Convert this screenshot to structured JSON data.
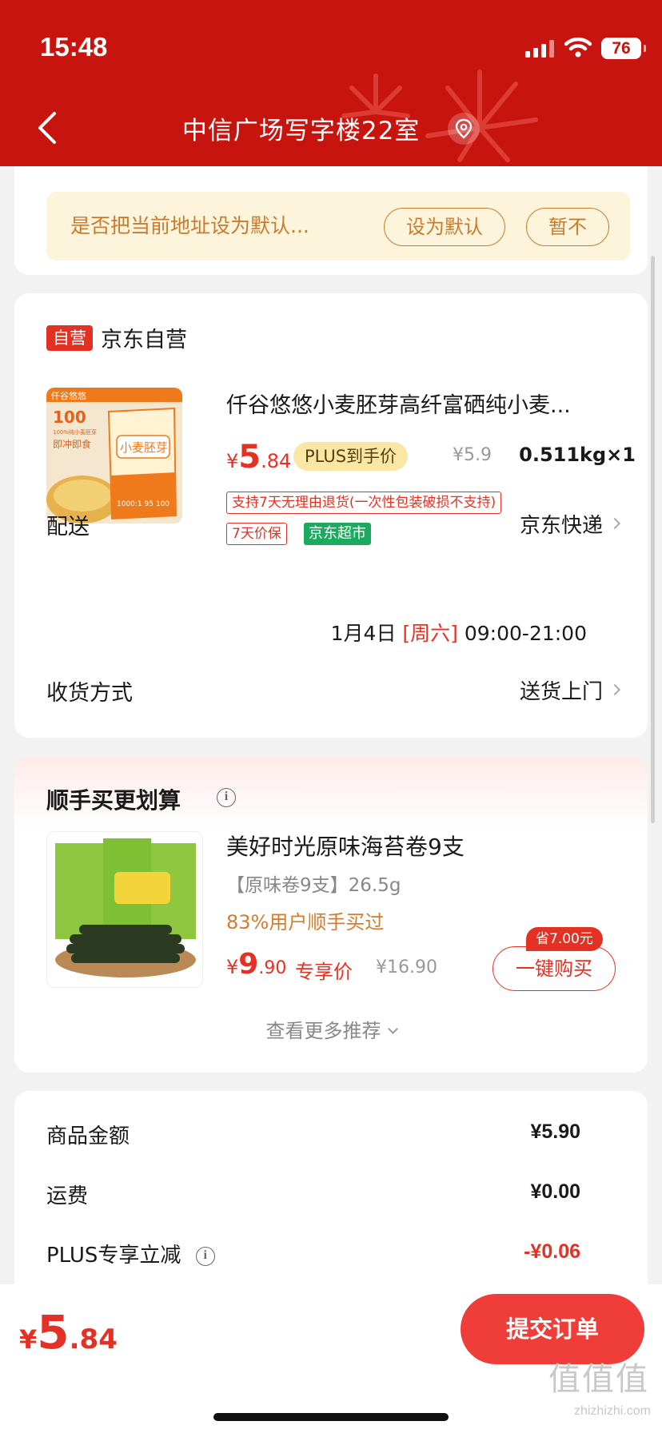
{
  "status": {
    "time": "15:48",
    "battery": "76"
  },
  "header": {
    "address": "中信广场写字楼22室"
  },
  "default_prompt": {
    "text": "是否把当前地址设为默认...",
    "set_default": "设为默认",
    "not_now": "暂不"
  },
  "store": {
    "self_tag": "自营",
    "name": "京东自营",
    "product": {
      "title": "仟谷悠悠小麦胚芽高纤富硒纯小麦...",
      "price_yen": "¥",
      "price_int": "5",
      "price_dec": ".84",
      "plus_label": "PLUS到手价",
      "orig_price": "¥5.9",
      "qty": "0.511kg×1",
      "tag_return": "支持7天无理由退货(一次性包装破损不支持)",
      "tag_price_protect": "7天价保",
      "tag_supermarket": "京东超市",
      "image_text": {
        "brand": "仟谷悠悠",
        "num": "100",
        "sub": "100%纯小麦胚芽",
        "instant": "即冲即食",
        "bag": "小麦胚芽",
        "bottom": "1000:1 95 100"
      }
    },
    "delivery_label": "配送",
    "delivery_value": "京东快递",
    "delivery_date": "1月4日",
    "delivery_weekday": "[周六]",
    "delivery_time": "09:00-21:00",
    "receive_label": "收货方式",
    "receive_value": "送货上门"
  },
  "recommend": {
    "title": "顺手买更划算",
    "name": "美好时光原味海苔卷9支",
    "spec": "【原味卷9支】26.5g",
    "bought": "83%用户顺手买过",
    "price_yen": "¥",
    "price_int": "9",
    "price_dec": ".90",
    "exclusive": "专享价",
    "orig_price": "¥16.90",
    "save_badge": "省7.00元",
    "buy_button": "一键购买",
    "see_more": "查看更多推荐"
  },
  "summary": {
    "rows": [
      {
        "label": "商品金额",
        "value": "¥5.90"
      },
      {
        "label": "运费",
        "value": "¥0.00"
      },
      {
        "label": "PLUS专享立减",
        "value": "-¥0.06"
      }
    ]
  },
  "bottom": {
    "total_yen": "¥",
    "total_int": "5",
    "total_dec": ".84",
    "submit": "提交订单",
    "watermark": "值值值",
    "watermark_sub": "zhizhizhi.com"
  },
  "colors": {
    "header": "#c8140f",
    "accent": "#e33224",
    "submit": "#ef3d3a"
  }
}
